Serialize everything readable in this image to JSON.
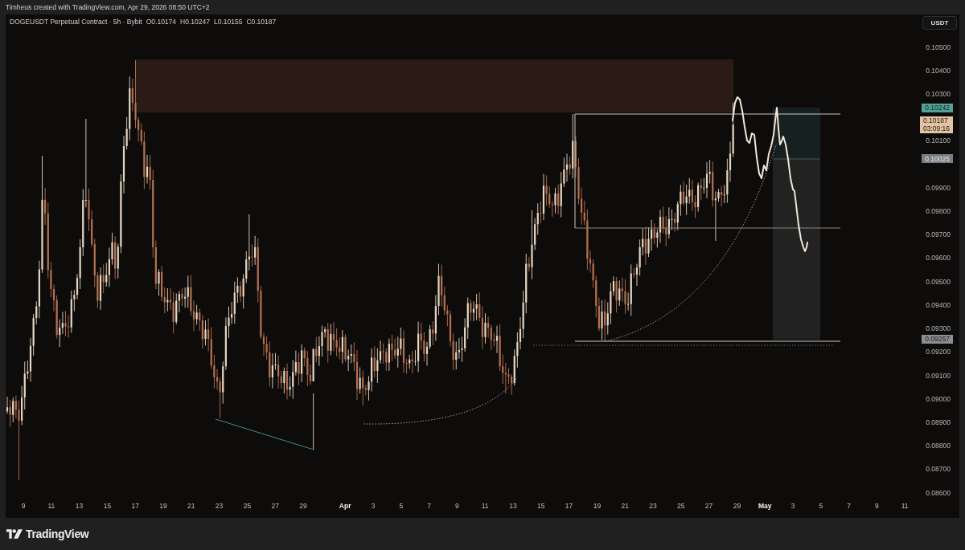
{
  "attribution": "Timheus created with TradingView.com, Apr 29, 2026 08:50 UTC+2",
  "chart": {
    "legend": {
      "title": "DOGEUSDT Perpetual Contract · 5h · Bybit",
      "values": [
        "O0.10174",
        "H0.10247",
        "L0.10155",
        "C0.10187"
      ]
    },
    "currency_button": "USDT",
    "price_axis": [
      "0.10500",
      "0.10400",
      "0.10300",
      "0.10100",
      "0.09900",
      "0.09800",
      "0.09700",
      "0.09600",
      "0.09500",
      "0.09400",
      "0.09300",
      "0.09200",
      "0.09100",
      "0.09000",
      "0.08900",
      "0.08800",
      "0.08700",
      "0.08600"
    ],
    "price_badges": [
      {
        "price": "0.10242",
        "color": "#4fa396"
      },
      {
        "price": "0.10187",
        "countdown": "03:09:16",
        "color": "#e2c3a2"
      },
      {
        "price": "0.10025",
        "color": "#7b7d84"
      },
      {
        "price": "0.09257",
        "color": "#8b8e95"
      }
    ],
    "time_axis": [
      {
        "label": "9",
        "kind": "day"
      },
      {
        "label": "11",
        "kind": "day"
      },
      {
        "label": "13",
        "kind": "day"
      },
      {
        "label": "15",
        "kind": "day"
      },
      {
        "label": "17",
        "kind": "day"
      },
      {
        "label": "19",
        "kind": "day"
      },
      {
        "label": "21",
        "kind": "day"
      },
      {
        "label": "23",
        "kind": "day"
      },
      {
        "label": "25",
        "kind": "day"
      },
      {
        "label": "27",
        "kind": "day"
      },
      {
        "label": "29",
        "kind": "day"
      },
      {
        "label": "Apr",
        "kind": "month"
      },
      {
        "label": "3",
        "kind": "day"
      },
      {
        "label": "5",
        "kind": "day"
      },
      {
        "label": "7",
        "kind": "day"
      },
      {
        "label": "9",
        "kind": "day"
      },
      {
        "label": "11",
        "kind": "day"
      },
      {
        "label": "13",
        "kind": "day"
      },
      {
        "label": "15",
        "kind": "day"
      },
      {
        "label": "17",
        "kind": "day"
      },
      {
        "label": "19",
        "kind": "day"
      },
      {
        "label": "21",
        "kind": "day"
      },
      {
        "label": "23",
        "kind": "day"
      },
      {
        "label": "25",
        "kind": "day"
      },
      {
        "label": "27",
        "kind": "day"
      },
      {
        "label": "29",
        "kind": "day"
      },
      {
        "label": "May",
        "kind": "month"
      },
      {
        "label": "3",
        "kind": "day"
      },
      {
        "label": "5",
        "kind": "day"
      },
      {
        "label": "7",
        "kind": "day"
      },
      {
        "label": "9",
        "kind": "day"
      },
      {
        "label": "11",
        "kind": "day"
      }
    ]
  },
  "footer": {
    "brand": "TradingView"
  }
}
